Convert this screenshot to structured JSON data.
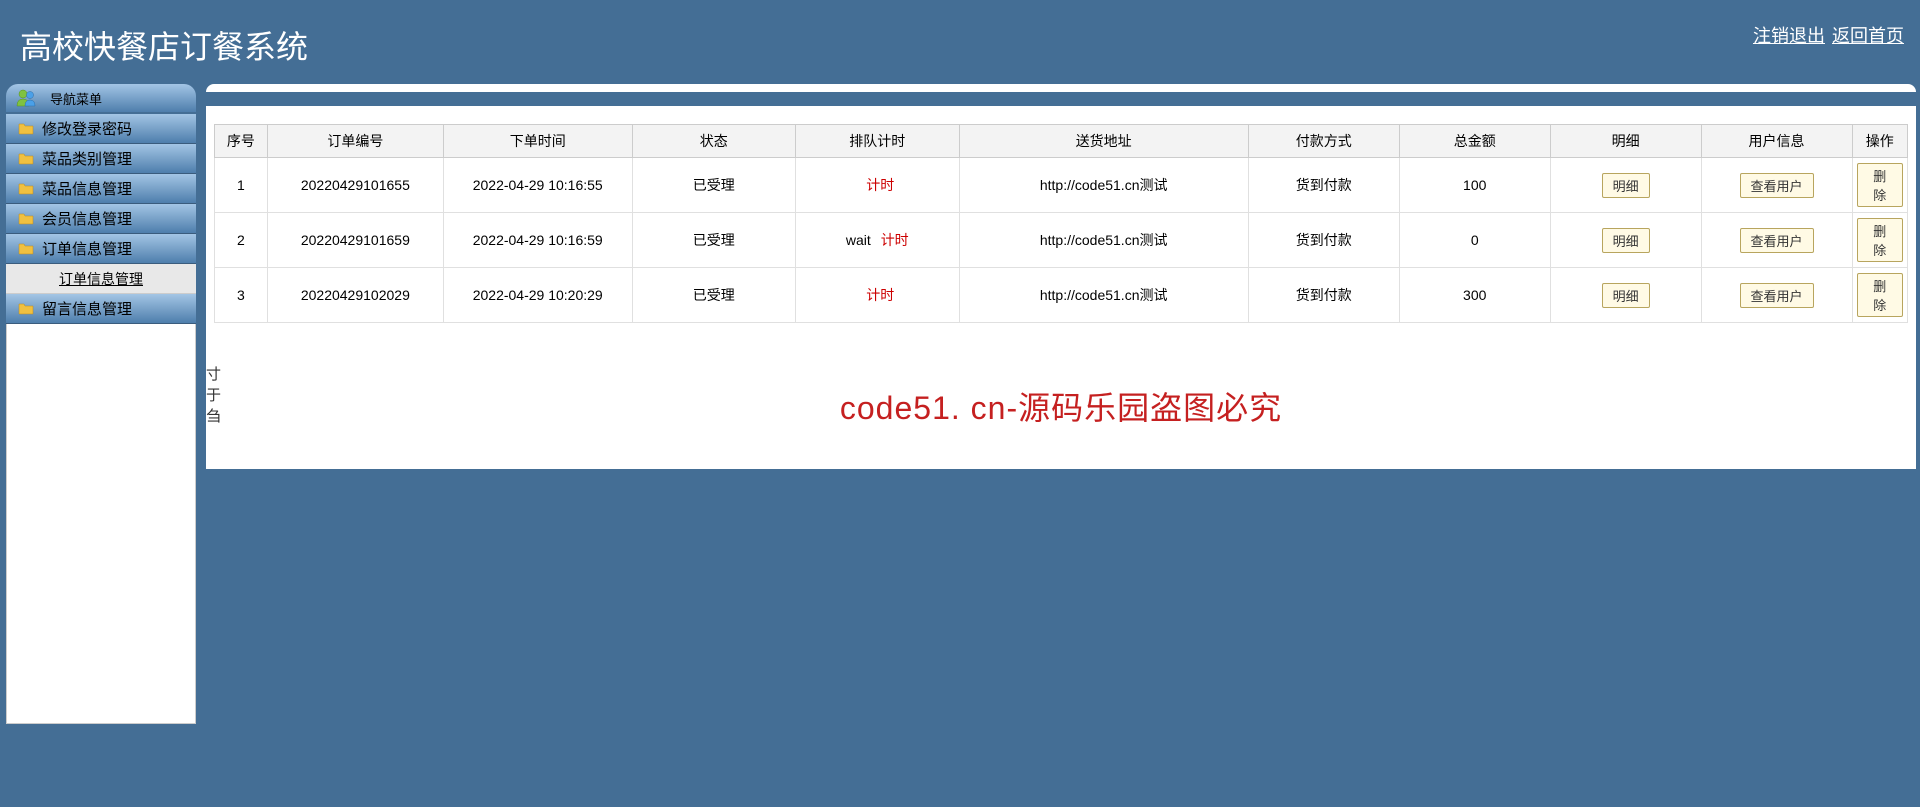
{
  "header": {
    "title": "高校快餐店订餐系统",
    "logout": "注销退出",
    "home": "返回首页"
  },
  "sidebar": {
    "nav_title": "导航菜单",
    "items": [
      {
        "label": "修改登录密码"
      },
      {
        "label": "菜品类别管理"
      },
      {
        "label": "菜品信息管理"
      },
      {
        "label": "会员信息管理"
      },
      {
        "label": "订单信息管理"
      }
    ],
    "sub_item": "订单信息管理",
    "last_item": "留言信息管理"
  },
  "table": {
    "headers": [
      "序号",
      "订单编号",
      "下单时间",
      "状态",
      "排队计时",
      "送货地址",
      "付款方式",
      "总金额",
      "明细",
      "用户信息",
      "操作"
    ],
    "timer_label": "计时",
    "detail_btn": "明细",
    "user_btn": "查看用户",
    "delete_btn": "删除",
    "rows": [
      {
        "seq": "1",
        "order_no": "20220429101655",
        "time": "2022-04-29 10:16:55",
        "status": "已受理",
        "queue_prefix": "",
        "addr": "http://code51.cn测试",
        "pay": "货到付款",
        "amount": "100"
      },
      {
        "seq": "2",
        "order_no": "20220429101659",
        "time": "2022-04-29 10:16:59",
        "status": "已受理",
        "queue_prefix": "wait ",
        "addr": "http://code51.cn测试",
        "pay": "货到付款",
        "amount": "0"
      },
      {
        "seq": "3",
        "order_no": "20220429102029",
        "time": "2022-04-29 10:20:29",
        "status": "已受理",
        "queue_prefix": "",
        "addr": "http://code51.cn测试",
        "pay": "货到付款",
        "amount": "300"
      }
    ]
  },
  "watermark": "code51. cn-源码乐园盗图必究",
  "ghost": [
    "寸",
    "于",
    "刍"
  ]
}
